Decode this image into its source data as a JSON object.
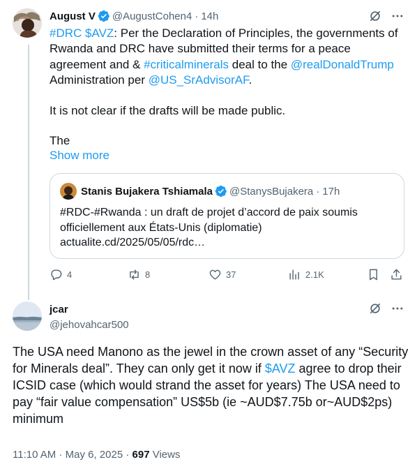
{
  "colors": {
    "link": "#1d9bf0",
    "muted": "#536471",
    "text": "#0f1419",
    "border": "#cfd9de",
    "verified": "#1d9bf0"
  },
  "parent_tweet": {
    "name": "August V",
    "handle": "@AugustCohen4",
    "sep": "·",
    "time": "14h",
    "text": {
      "l1_tag1": "#DRC",
      "l1_sp": " ",
      "l1_tag2": "$AVZ",
      "l1_rest": ": Per the Declaration of Principles, the governments of Rwanda and DRC have submitted their terms for a peace agreement and & ",
      "tag3": "#criticalminerals",
      "mid": " deal to the ",
      "mention1": "@realDonaldTrump",
      "admin": " Administration per ",
      "mention2": "@US_SrAdvisorAF",
      "end": ".",
      "para2": "It is not clear if the drafts will be made public.",
      "para3": "The"
    },
    "show_more": "Show more",
    "quote": {
      "name": "Stanis Bujakera Tshiamala",
      "handle": "@StanysBujakera",
      "sep": "·",
      "time": "17h",
      "text": "#RDC-#Rwanda : un draft de projet d’accord de paix soumis officiellement aux États-Unis (diplomatie) actualite.cd/2025/05/05/rdc…"
    },
    "actions": {
      "replies": "4",
      "reposts": "8",
      "likes": "37",
      "views": "2.1K"
    },
    "icons": [
      "grok-icon",
      "more-icon",
      "reply-icon",
      "repost-icon",
      "like-icon",
      "views-icon",
      "bookmark-icon",
      "share-icon"
    ]
  },
  "reply_tweet": {
    "name": "jcar",
    "handle": "@jehovahcar500",
    "text_a": "The USA need Manono as the jewel in the crown asset of any “Security for Minerals deal”. They can only get it now if ",
    "cashtag": "$AVZ",
    "text_b": " agree to drop their ICSID case (which would strand the asset for years) The USA need to pay “fair value compensation” US$5b (ie ~AUD$7.75b or~AUD$2ps) minimum",
    "time": "11:10 AM",
    "sep": " · ",
    "date": "May 6, 2025",
    "sep2": " · ",
    "views_count": "697",
    "views_label": " Views"
  }
}
